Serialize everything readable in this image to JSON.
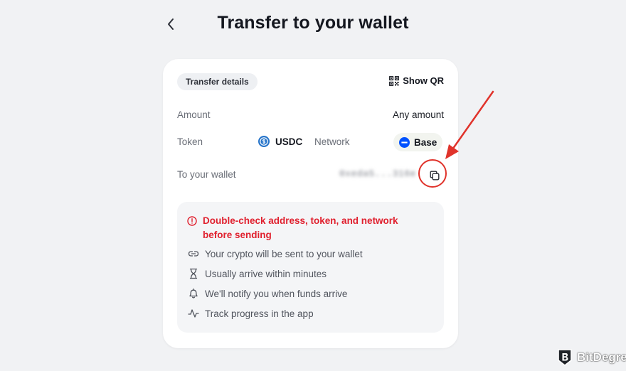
{
  "header": {
    "title": "Transfer to your wallet",
    "back_icon": "chevron-left-icon"
  },
  "card": {
    "tab_label": "Transfer details",
    "show_qr_label": "Show QR",
    "amount_label": "Amount",
    "amount_value": "Any amount",
    "token_label": "Token",
    "token_value": "USDC",
    "network_label": "Network",
    "network_value": "Base",
    "wallet_label": "To your wallet",
    "wallet_address": "0xeda5...316e"
  },
  "info": {
    "warning": "Double-check address, token, and network before sending",
    "items": [
      {
        "icon": "link-icon",
        "text": "Your crypto will be sent to your wallet"
      },
      {
        "icon": "hourglass-icon",
        "text": "Usually arrive within minutes"
      },
      {
        "icon": "bell-icon",
        "text": "We'll notify you when funds arrive"
      },
      {
        "icon": "activity-icon",
        "text": "Track progress in the app"
      }
    ]
  },
  "colors": {
    "warning": "#e0202e",
    "annotation": "#e0332b",
    "usdc": "#2775ca",
    "base": "#0052ff"
  },
  "watermark": {
    "text": "BitDegree"
  }
}
